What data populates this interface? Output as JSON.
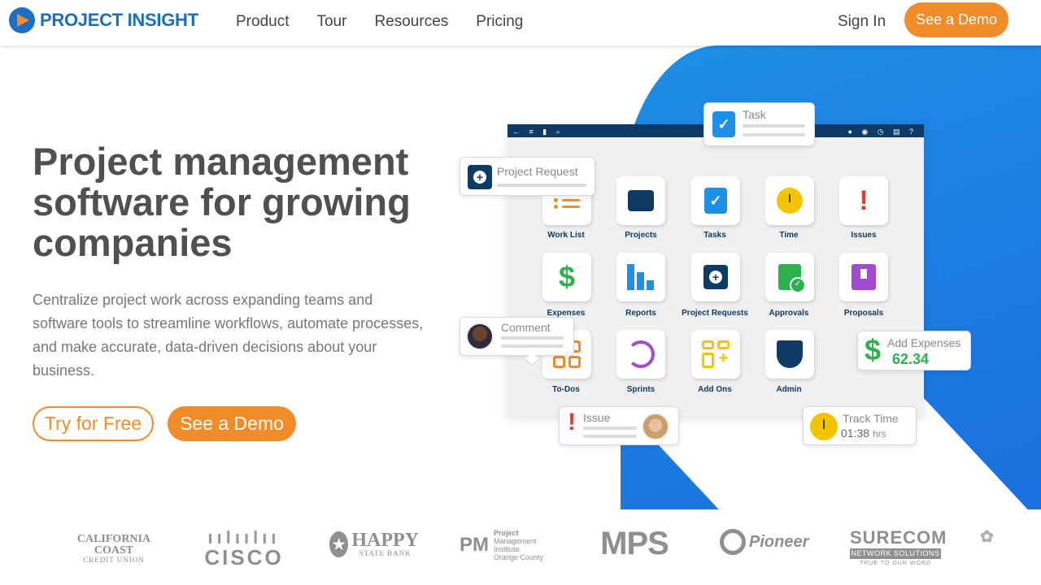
{
  "header": {
    "logo_text": "PROJECT INSIGHT",
    "nav": [
      "Product",
      "Tour",
      "Resources",
      "Pricing"
    ],
    "sign_in": "Sign In",
    "see_demo": "See a Demo"
  },
  "hero": {
    "title": "Project management software for growing companies",
    "description": "Centralize project work across expanding teams and software tools to streamline workflows, automate processes, and make accurate, data-driven decisions about your business.",
    "try_free": "Try for Free",
    "see_demo": "See a Demo"
  },
  "mockup": {
    "tiles": [
      "Work List",
      "Projects",
      "Tasks",
      "Time",
      "Issues",
      "Expenses",
      "Reports",
      "Project Requests",
      "Approvals",
      "Proposals",
      "To-Dos",
      "Sprints",
      "Add Ons",
      "Admin"
    ],
    "cards": {
      "task": "Task",
      "project_request": "Project Request",
      "comment": "Comment",
      "add_expenses": "Add Expenses",
      "expense_value": "62.34",
      "issue": "Issue",
      "track_time": "Track Time",
      "time_value": "01:38",
      "time_unit": "hrs"
    }
  },
  "clients": {
    "california_coast": "CALIFORNIA COAST",
    "california_coast_sub": "CREDIT UNION",
    "cisco": "CISCO",
    "happy": "HAPPY",
    "happy_sub": "STATE BANK",
    "pmi_line1": "Project",
    "pmi_line2": "Management",
    "pmi_line3": "Institute.",
    "pmi_line4": "Orange County",
    "mps": "MPS",
    "pioneer": "Pioneer",
    "surecom": "SURECOM",
    "surecom_sub": "NETWORK SOLUTIONS",
    "surecom_tag": "TRUE TO OUR WORD"
  },
  "colors": {
    "brand_blue": "#1b6fc2",
    "accent_orange": "#f28c28",
    "hero_blue": "#1e8fe6"
  }
}
